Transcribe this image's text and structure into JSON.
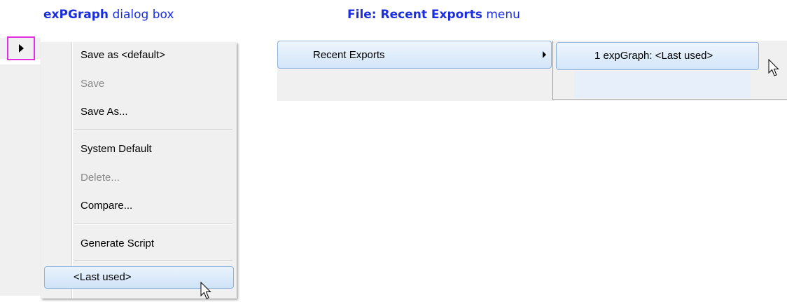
{
  "captions": {
    "left_bold": "exPGraph",
    "left_rest": " dialog box",
    "right_bold": "File: Recent Exports",
    "right_rest": " menu"
  },
  "dialog_menu": {
    "items": [
      {
        "label": "Save as <default>",
        "enabled": true
      },
      {
        "label": "Save",
        "enabled": false
      },
      {
        "label": "Save As...",
        "enabled": true
      },
      {
        "label": "System Default",
        "enabled": true
      },
      {
        "label": "Delete...",
        "enabled": false
      },
      {
        "label": "Compare...",
        "enabled": true
      },
      {
        "label": "Generate Script",
        "enabled": true
      }
    ],
    "highlighted": "<Last used>"
  },
  "file_menu": {
    "recent_exports_label": "Recent Exports",
    "submenu_item": "1 expGraph: <Last used>"
  },
  "colors": {
    "caption": "#1a2ee0",
    "arrow_button_border": "#e52ee0",
    "highlight_border": "#8fb3dc"
  },
  "icons": [
    "play-arrow-icon",
    "submenu-arrow-icon",
    "mouse-cursor-icon"
  ]
}
